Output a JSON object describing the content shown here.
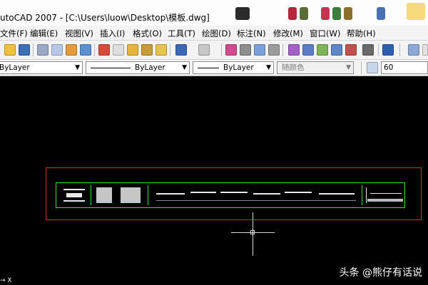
{
  "window": {
    "title": "utoCAD 2007 - [C:\\Users\\luow\\Desktop\\模板.dwg]"
  },
  "menu": [
    "文件(F)",
    "编辑(E)",
    "视图(V)",
    "插入(I)",
    "格式(O)",
    "工具(T)",
    "绘图(D)",
    "标注(N)",
    "修改(M)",
    "窗口(W)",
    "帮助(H)"
  ],
  "properties": {
    "layer": "ByLayer",
    "linetype": "ByLayer",
    "lineweight": "ByLayer",
    "color": "随颜色",
    "text_height": "60"
  },
  "ucs_label": "X",
  "watermark": "头条 @熊仔有话说",
  "colors": {
    "accent_frame": "#d4302f",
    "drawing_border": "#3ee23e"
  }
}
